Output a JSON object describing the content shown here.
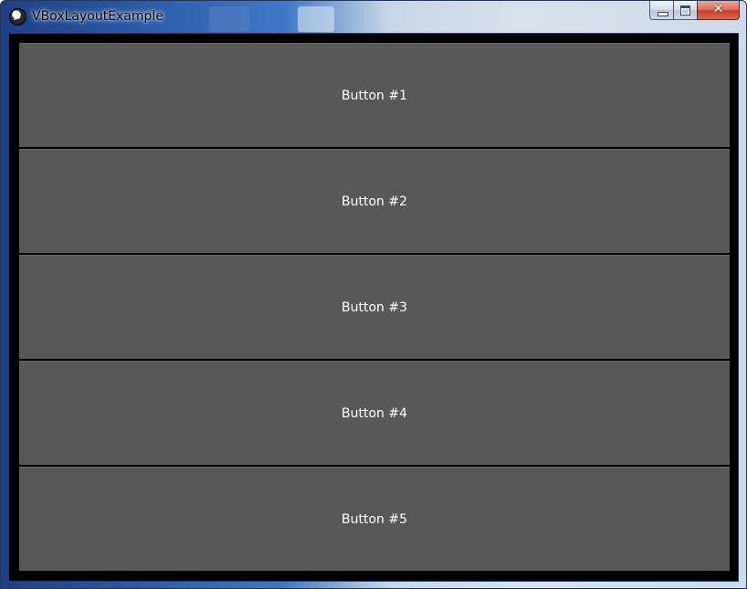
{
  "window": {
    "title": "VBoxLayoutExample",
    "icon": "kivy-logo-icon",
    "controls": {
      "minimize": "minimize-icon",
      "maximize": "maximize-icon",
      "close_label": "✕"
    }
  },
  "buttons": [
    {
      "label": "Button #1"
    },
    {
      "label": "Button #2"
    },
    {
      "label": "Button #3"
    },
    {
      "label": "Button #4"
    },
    {
      "label": "Button #5"
    }
  ],
  "colors": {
    "client_background": "#000000",
    "button_background": "#585858",
    "button_text": "#ffffff",
    "close_button": "#c4412a"
  }
}
